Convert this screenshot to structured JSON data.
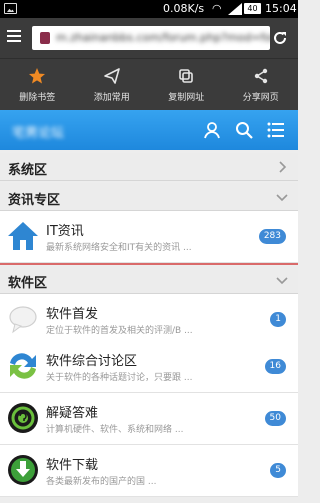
{
  "status_bar": {
    "speed": "0.08K/s",
    "battery": "40",
    "time": "15:04"
  },
  "url_bar": {
    "url": "m.zhainanbbs.com/forum.php?mod=forumdisplay"
  },
  "actions": [
    {
      "label": "删除书签",
      "icon": "star-icon"
    },
    {
      "label": "添加常用",
      "icon": "send-icon"
    },
    {
      "label": "复制网址",
      "icon": "copy-icon"
    },
    {
      "label": "分享网页",
      "icon": "share-icon"
    }
  ],
  "header": {
    "site_name": "宅男论坛"
  },
  "sections": [
    {
      "label": "系统区"
    },
    {
      "label": "资讯专区"
    },
    {
      "label": "软件区"
    }
  ],
  "rows": [
    {
      "title": "IT资讯",
      "desc": "最新系统网络安全和IT有关的资讯 ...",
      "count": "283",
      "icon": "house-icon"
    },
    {
      "title": "软件首发",
      "desc": "定位于软件的首发及相关的评测/B ...",
      "count": "1",
      "icon": "speech-bubble-icon"
    },
    {
      "title": "软件综合讨论区",
      "desc": "关于软件的各种话题讨论，只要跟 ...",
      "count": "16",
      "icon": "swap-arrows-icon"
    },
    {
      "title": "解疑答难",
      "desc": "计算机硬件、软件、系统和网络 ...",
      "count": "50",
      "icon": "disc-icon"
    },
    {
      "title": "软件下载",
      "desc": "各类最新发布的国产的国 ...",
      "count": "5",
      "icon": "download-icon"
    }
  ],
  "colors": {
    "accent": "#2196e8",
    "badge": "#3f8ad6",
    "dark_bar": "#3b3b3b"
  }
}
